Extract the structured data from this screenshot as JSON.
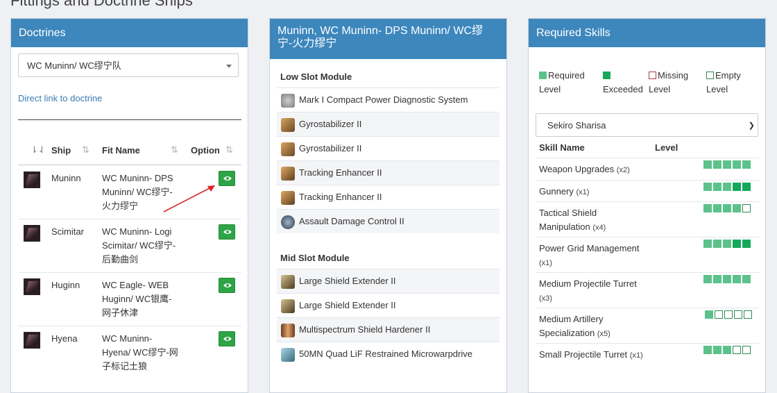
{
  "page": {
    "title": "Fittings and Doctrine Ships"
  },
  "doctrines": {
    "heading": "Doctrines",
    "selected": "WC Muninn/ WC缪宁队",
    "direct_link": "Direct link to doctrine",
    "columns": {
      "ship": "Ship",
      "fit_name": "Fit Name",
      "option": "Option"
    },
    "rows": [
      {
        "ship": "Muninn",
        "fit": [
          "WC Muninn- DPS",
          "Muninn/ WC缪宁-",
          "火力缪宁"
        ]
      },
      {
        "ship": "Scimitar",
        "fit": [
          "WC Muninn- Logi",
          "Scimitar/ WC缪宁-",
          "后勤曲剑"
        ]
      },
      {
        "ship": "Huginn",
        "fit": [
          "WC Eagle- WEB",
          "Huginn/ WC银鹰-",
          "网子休津"
        ]
      },
      {
        "ship": "Hyena",
        "fit": [
          "WC Muninn-",
          "Hyena/ WC缪宁-网",
          "子标记土狼"
        ]
      }
    ]
  },
  "fitting": {
    "heading_lines": [
      "Muninn, WC Muninn- DPS Muninn/ WC缪",
      "宁-火力缪宁"
    ],
    "low_slot_title": "Low Slot Module",
    "low_slots": [
      "Mark I Compact Power Diagnostic System",
      "Gyrostabilizer II",
      "Gyrostabilizer II",
      "Tracking Enhancer II",
      "Tracking Enhancer II",
      "Assault Damage Control II"
    ],
    "mid_slot_title": "Mid Slot Module",
    "mid_slots": [
      "Large Shield Extender II",
      "Large Shield Extender II",
      "Multispectrum Shield Hardener II",
      "50MN Quad LiF Restrained Microwarpdrive"
    ]
  },
  "skills": {
    "heading": "Required Skills",
    "legend": {
      "required": [
        "Required",
        "Level"
      ],
      "exceeded": [
        "",
        "Exceeded"
      ],
      "missing": [
        "Missing",
        "Level"
      ],
      "empty": [
        "Empty",
        "Level"
      ]
    },
    "character": "Sekiro Sharisa",
    "columns": {
      "name": "Skill Name",
      "level": "Level"
    },
    "colors": {
      "required": "#5cc28b",
      "exceeded": "#16a85a",
      "missing": "#b23a3a",
      "empty": "#2e8b57"
    },
    "rows": [
      {
        "name": [
          "Weapon Upgrades"
        ],
        "mult": "(x2)",
        "levels": [
          "req",
          "req",
          "req",
          "req",
          "req"
        ]
      },
      {
        "name": [
          "Gunnery"
        ],
        "mult": "(x1)",
        "levels": [
          "req",
          "req",
          "req",
          "exc",
          "exc"
        ]
      },
      {
        "name": [
          "Tactical Shield",
          "Manipulation"
        ],
        "mult": "(x4)",
        "levels": [
          "req",
          "req",
          "req",
          "req",
          "empty"
        ]
      },
      {
        "name": [
          "Power Grid Management",
          ""
        ],
        "mult": "(x1)",
        "levels": [
          "req",
          "req",
          "req",
          "exc",
          "exc"
        ]
      },
      {
        "name": [
          "Medium Projectile Turret",
          ""
        ],
        "mult": "(x3)",
        "levels": [
          "req",
          "req",
          "req",
          "req",
          "req"
        ]
      },
      {
        "name": [
          "Medium Artillery",
          "Specialization"
        ],
        "mult": "(x5)",
        "levels": [
          "req",
          "empty",
          "empty",
          "empty",
          "empty"
        ]
      },
      {
        "name": [
          "Small Projectile Turret"
        ],
        "mult": "(x1)",
        "levels": [
          "req",
          "req",
          "req",
          "empty",
          "empty"
        ]
      }
    ]
  }
}
